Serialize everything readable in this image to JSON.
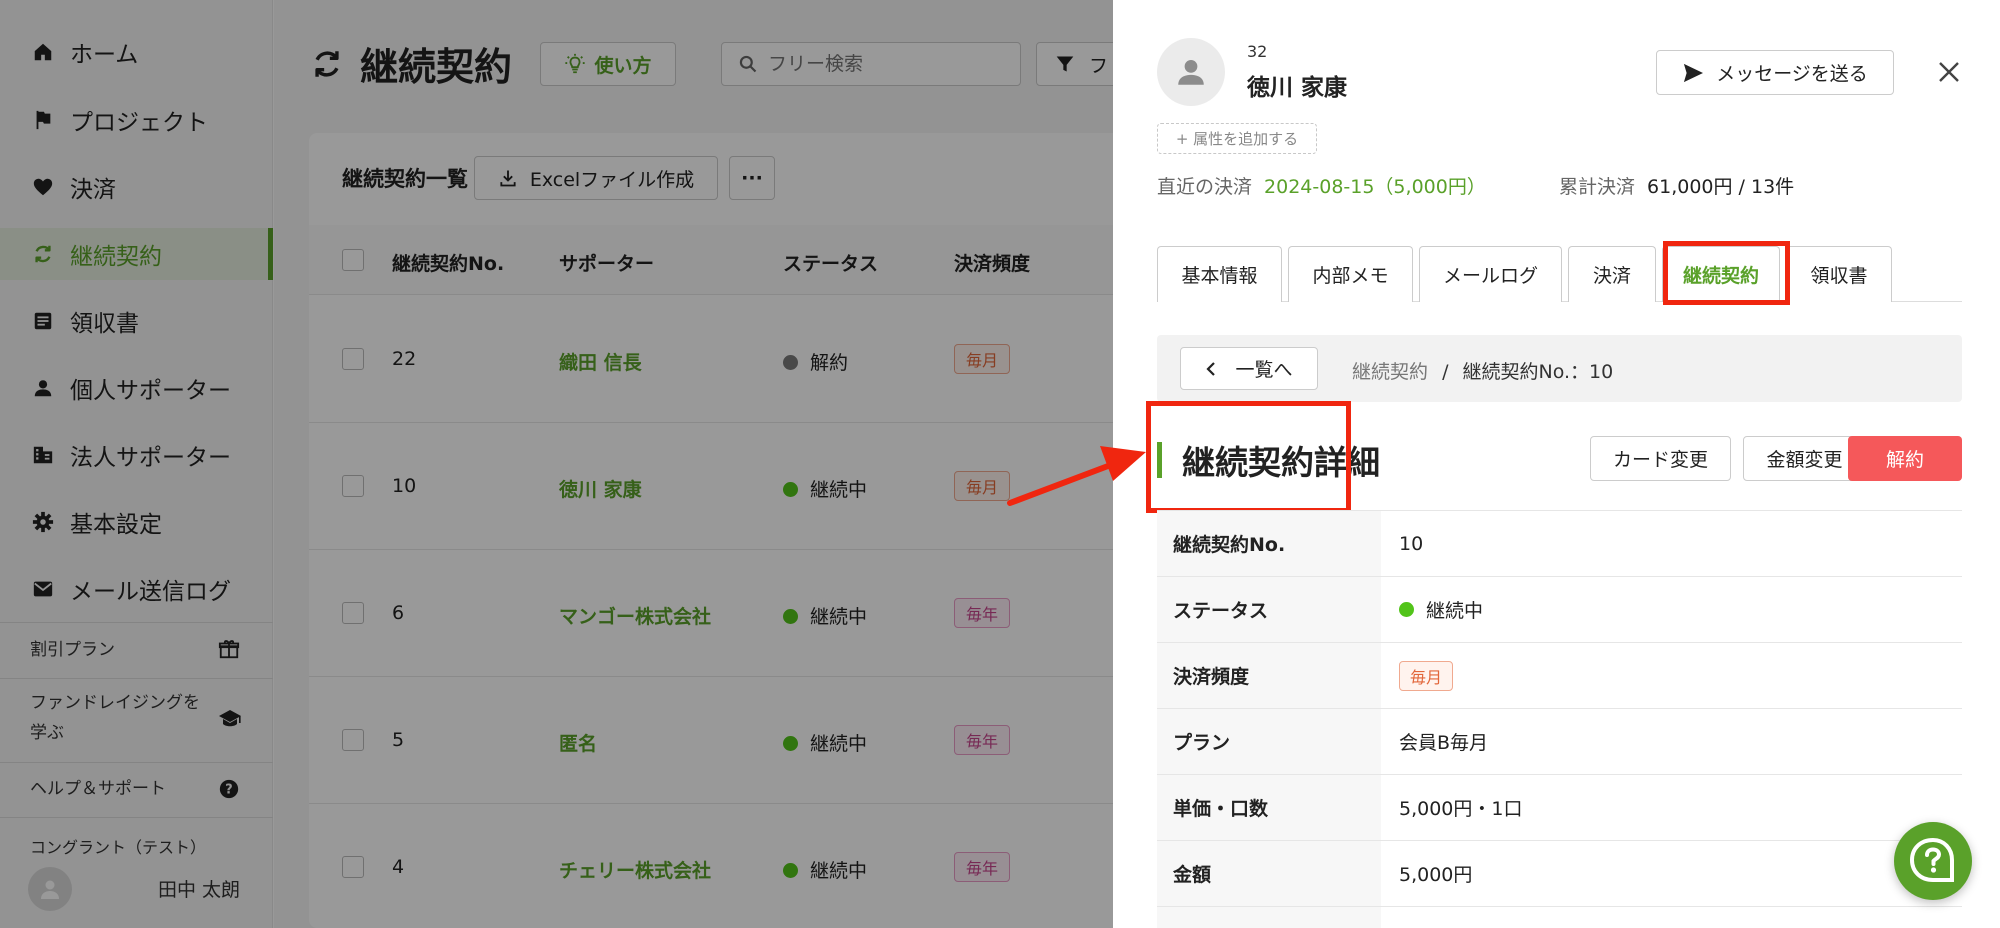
{
  "sidebar": {
    "items": [
      {
        "label": "ホーム",
        "icon": "home-icon"
      },
      {
        "label": "プロジェクト",
        "icon": "flag-icon"
      },
      {
        "label": "決済",
        "icon": "heart-icon"
      },
      {
        "label": "継続契約",
        "icon": "refresh-icon",
        "active": true
      },
      {
        "label": "領収書",
        "icon": "receipt-icon"
      },
      {
        "label": "個人サポーター",
        "icon": "person-icon"
      },
      {
        "label": "法人サポーター",
        "icon": "building-icon"
      },
      {
        "label": "基本設定",
        "icon": "gear-icon"
      },
      {
        "label": "メール送信ログ",
        "icon": "mail-icon"
      }
    ],
    "discount_plan": "割引プラン",
    "learn_line1": "ファンドレイジングを",
    "learn_line2": "学ぶ",
    "help": "ヘルプ＆サポート",
    "org_name": "コングラント（テスト）",
    "user_name": "田中 太朗"
  },
  "main": {
    "title": "継続契約",
    "howto_label": "使い方",
    "search_placeholder": "フリー検索",
    "filter_label": "フ",
    "list_title": "継続契約一覧",
    "excel_label": "Excelファイル作成",
    "more_label": "···",
    "columns": [
      "継続契約No.",
      "サポーター",
      "ステータス",
      "決済頻度"
    ],
    "rows": [
      {
        "no": "22",
        "supporter": "織田 信長",
        "status": "解約",
        "status_color": "#7a7a7a",
        "freq": "毎月",
        "yearly": false
      },
      {
        "no": "10",
        "supporter": "徳川 家康",
        "status": "継続中",
        "status_color": "#52c41a",
        "freq": "毎月",
        "yearly": false
      },
      {
        "no": "6",
        "supporter": "マンゴー株式会社",
        "status": "継続中",
        "status_color": "#52c41a",
        "freq": "毎年",
        "yearly": true
      },
      {
        "no": "5",
        "supporter": "匿名",
        "status": "継続中",
        "status_color": "#52c41a",
        "freq": "毎年",
        "yearly": true
      },
      {
        "no": "4",
        "supporter": "チェリー株式会社",
        "status": "継続中",
        "status_color": "#52c41a",
        "freq": "毎年",
        "yearly": true
      }
    ]
  },
  "drawer": {
    "supporter_id": "32",
    "supporter_name": "徳川 家康",
    "message_label": "メッセージを送る",
    "add_attr_label": "+ 属性を追加する",
    "recent_label": "直近の決済",
    "recent_value": "2024-08-15（5,000円）",
    "total_label": "累計決済",
    "total_value": "61,000円 / 13件",
    "tabs": [
      "基本情報",
      "内部メモ",
      "メールログ",
      "決済",
      "継続契約",
      "領収書"
    ],
    "active_tab": 4,
    "back_label": "一覧へ",
    "crumb_parent": "継続契約",
    "crumb_sep": "/",
    "crumb_current": "継続契約No.：10",
    "detail_title": "継続契約詳細",
    "card_change_label": "カード変更",
    "amount_change_label": "金額変更",
    "cancel_label": "解約",
    "details": [
      {
        "label": "継続契約No.",
        "value": "10"
      },
      {
        "label": "ステータス",
        "value": "継続中"
      },
      {
        "label": "決済頻度",
        "value": "毎月"
      },
      {
        "label": "プラン",
        "value": "会員B毎月"
      },
      {
        "label": "単価・口数",
        "value": "5,000円・1口"
      },
      {
        "label": "金額",
        "value": "5,000円"
      }
    ]
  },
  "colors": {
    "accent": "#5aa12a",
    "annotation": "#f0260f",
    "danger": "#f5585a",
    "active_status": "#52c41a"
  }
}
